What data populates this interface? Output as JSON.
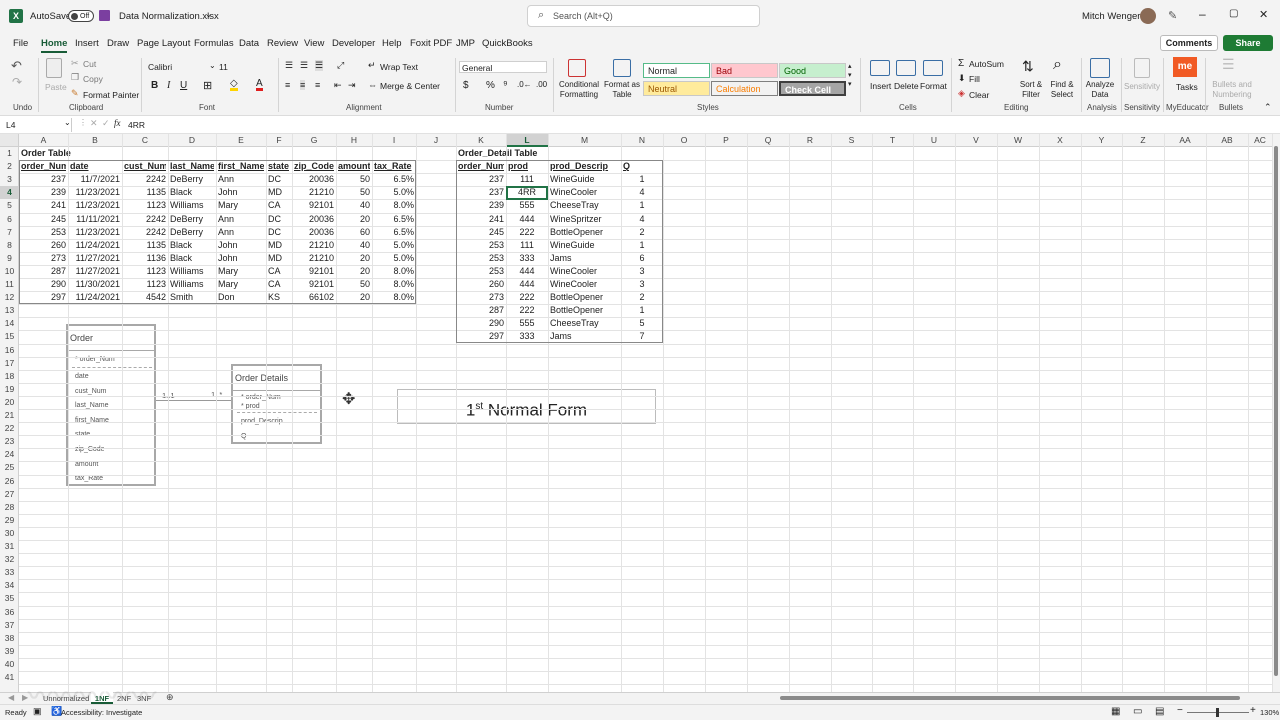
{
  "titlebar": {
    "autosave_label": "AutoSave",
    "autosave_state": "Off",
    "file_name": "Data Normalization.xlsx",
    "search_placeholder": "Search (Alt+Q)",
    "user_name": "Mitch Wenger"
  },
  "menu": {
    "items": [
      "File",
      "Home",
      "Insert",
      "Draw",
      "Page Layout",
      "Formulas",
      "Data",
      "Review",
      "View",
      "Developer",
      "Help",
      "Foxit PDF",
      "JMP",
      "QuickBooks"
    ],
    "active": "Home",
    "comments_label": "Comments",
    "share_label": "Share"
  },
  "ribbon": {
    "undo_label": "Undo",
    "clipboard": {
      "paste": "Paste",
      "cut": "Cut",
      "copy": "Copy",
      "format_painter": "Format Painter",
      "group": "Clipboard"
    },
    "font": {
      "name": "Calibri",
      "size": "11",
      "group": "Font"
    },
    "alignment": {
      "wrap": "Wrap Text",
      "merge": "Merge & Center",
      "group": "Alignment"
    },
    "number": {
      "format": "General",
      "group": "Number"
    },
    "styles": {
      "conditional": "Conditional Formatting",
      "format_table": "Format as Table",
      "normal": "Normal",
      "bad": "Bad",
      "good": "Good",
      "neutral": "Neutral",
      "calculation": "Calculation",
      "check_cell": "Check Cell",
      "group": "Styles"
    },
    "cells": {
      "insert": "Insert",
      "delete": "Delete",
      "format": "Format",
      "group": "Cells"
    },
    "editing": {
      "autosum": "AutoSum",
      "fill": "Fill",
      "clear": "Clear",
      "sort": "Sort & Filter",
      "find": "Find & Select",
      "group": "Editing"
    },
    "analysis": {
      "analyze": "Analyze Data",
      "group": "Analysis"
    },
    "sensitivity": {
      "label": "Sensitivity",
      "group": "Sensitivity"
    },
    "myeducator": {
      "tasks": "Tasks",
      "group": "MyEducator"
    },
    "bullets": {
      "label": "Bullets and Numbering",
      "group": "Bullets"
    }
  },
  "formula_bar": {
    "name_box": "L4",
    "formula": "4RR"
  },
  "columns": [
    "A",
    "B",
    "C",
    "D",
    "E",
    "F",
    "G",
    "H",
    "I",
    "J",
    "K",
    "L",
    "M",
    "N",
    "O",
    "P",
    "Q",
    "R",
    "S",
    "T",
    "U",
    "V",
    "W",
    "X",
    "Y",
    "Z",
    "AA",
    "AB",
    "AC"
  ],
  "rows": [
    "1",
    "2",
    "3",
    "4",
    "5",
    "6",
    "7",
    "8",
    "9",
    "10",
    "11",
    "12",
    "13",
    "14",
    "15",
    "16",
    "17",
    "18",
    "19",
    "20",
    "21",
    "22",
    "23",
    "24",
    "25",
    "26",
    "27",
    "28",
    "29",
    "30",
    "31",
    "32",
    "33",
    "34",
    "35",
    "36",
    "37",
    "38",
    "39",
    "40",
    "41"
  ],
  "order_table": {
    "title": "Order Table",
    "headers": [
      "order_Num",
      "date",
      "cust_Num",
      "last_Name",
      "first_Name",
      "state",
      "zip_Code",
      "amount",
      "tax_Rate"
    ],
    "rows": [
      [
        "237",
        "11/7/2021",
        "2242",
        "DeBerry",
        "Ann",
        "DC",
        "20036",
        "50",
        "6.5%"
      ],
      [
        "239",
        "11/23/2021",
        "1135",
        "Black",
        "John",
        "MD",
        "21210",
        "50",
        "5.0%"
      ],
      [
        "241",
        "11/23/2021",
        "1123",
        "Williams",
        "Mary",
        "CA",
        "92101",
        "40",
        "8.0%"
      ],
      [
        "245",
        "11/11/2021",
        "2242",
        "DeBerry",
        "Ann",
        "DC",
        "20036",
        "20",
        "6.5%"
      ],
      [
        "253",
        "11/23/2021",
        "2242",
        "DeBerry",
        "Ann",
        "DC",
        "20036",
        "60",
        "6.5%"
      ],
      [
        "260",
        "11/24/2021",
        "1135",
        "Black",
        "John",
        "MD",
        "21210",
        "40",
        "5.0%"
      ],
      [
        "273",
        "11/27/2021",
        "1136",
        "Black",
        "John",
        "MD",
        "21210",
        "20",
        "5.0%"
      ],
      [
        "287",
        "11/27/2021",
        "1123",
        "Williams",
        "Mary",
        "CA",
        "92101",
        "20",
        "8.0%"
      ],
      [
        "290",
        "11/30/2021",
        "1123",
        "Williams",
        "Mary",
        "CA",
        "92101",
        "50",
        "8.0%"
      ],
      [
        "297",
        "11/24/2021",
        "4542",
        "Smith",
        "Don",
        "KS",
        "66102",
        "20",
        "8.0%"
      ]
    ]
  },
  "order_detail_table": {
    "title": "Order_Detail Table",
    "headers": [
      "order_Num",
      "prod",
      "prod_Descrip",
      "Q"
    ],
    "rows": [
      [
        "237",
        "111",
        "WineGuide",
        "1"
      ],
      [
        "237",
        "4RR",
        "WineCooler",
        "4"
      ],
      [
        "239",
        "555",
        "CheeseTray",
        "1"
      ],
      [
        "241",
        "444",
        "WineSpritzer",
        "4"
      ],
      [
        "245",
        "222",
        "BottleOpener",
        "2"
      ],
      [
        "253",
        "111",
        "WineGuide",
        "1"
      ],
      [
        "253",
        "333",
        "Jams",
        "6"
      ],
      [
        "253",
        "444",
        "WineCooler",
        "3"
      ],
      [
        "260",
        "444",
        "WineCooler",
        "3"
      ],
      [
        "273",
        "222",
        "BottleOpener",
        "2"
      ],
      [
        "287",
        "222",
        "BottleOpener",
        "1"
      ],
      [
        "290",
        "555",
        "CheeseTray",
        "5"
      ],
      [
        "297",
        "333",
        "Jams",
        "7"
      ]
    ]
  },
  "erd": {
    "order": {
      "title": "Order",
      "pk": "* order_Num",
      "fields": [
        "date",
        "cust_Num",
        "last_Name",
        "first_Name",
        "state",
        "zip_Code",
        "amount",
        "tax_Rate"
      ]
    },
    "order_details": {
      "title": "Order Details",
      "pk": [
        "* order_Num",
        "* prod"
      ],
      "fields": [
        "prod_Descrip",
        "Q"
      ]
    },
    "card_left": "1..1",
    "card_right": "1..*"
  },
  "callout": {
    "main": "1",
    "sup": "st",
    "rest": " Normal Form"
  },
  "sheets": {
    "tabs": [
      "Unnormalized",
      "1NF",
      "2NF",
      "3NF"
    ],
    "active": "1NF"
  },
  "status": {
    "ready": "Ready",
    "accessibility": "Accessibility: Investigate",
    "zoom": "130%"
  },
  "colors": {
    "excel_green": "#217346",
    "share_green": "#1e7b34",
    "active_tab": "#185c37"
  }
}
